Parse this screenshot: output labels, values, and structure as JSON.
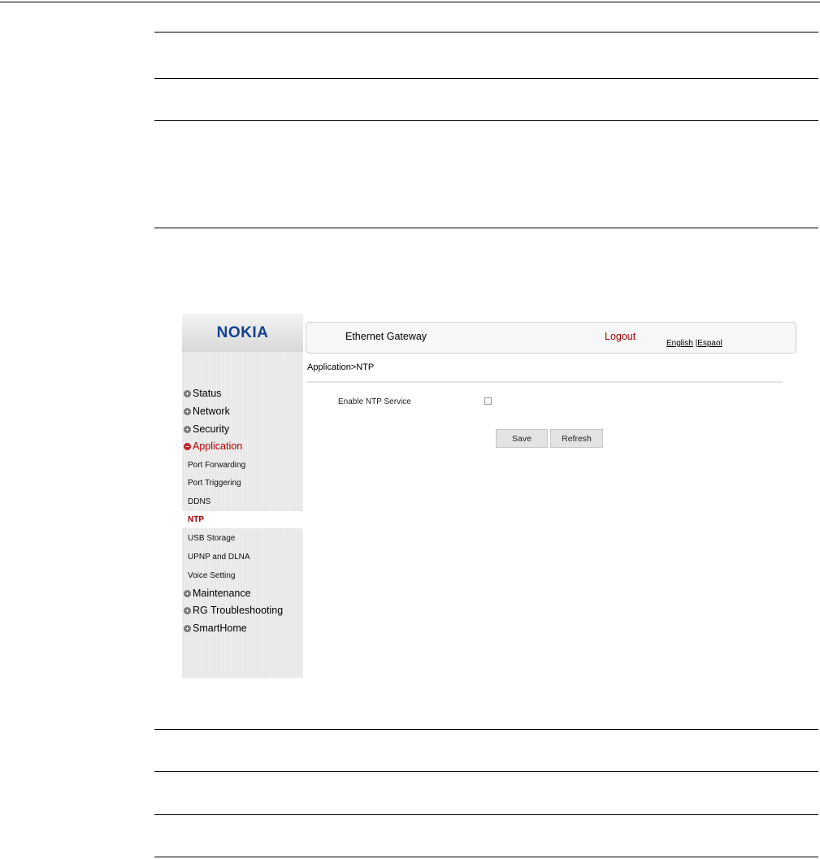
{
  "app": {
    "brand": "NOKIA",
    "header_title": "Ethernet Gateway",
    "logout": "Logout"
  },
  "language": {
    "english": "English",
    "separator": "|",
    "spanish": "Espaol"
  },
  "breadcrumb": "Application>NTP",
  "sidebar": {
    "top_items": [
      {
        "label": "Status",
        "state": "collapsed"
      },
      {
        "label": "Network",
        "state": "collapsed"
      },
      {
        "label": "Security",
        "state": "collapsed"
      },
      {
        "label": "Application",
        "state": "expanded"
      },
      {
        "label": "Maintenance",
        "state": "collapsed"
      },
      {
        "label": "RG Troubleshooting",
        "state": "collapsed"
      },
      {
        "label": "SmartHome",
        "state": "collapsed"
      }
    ],
    "sub_items": [
      {
        "label": "Port Forwarding"
      },
      {
        "label": "Port Triggering"
      },
      {
        "label": "DDNS"
      },
      {
        "label": "NTP",
        "selected": true
      },
      {
        "label": "USB Storage"
      },
      {
        "label": "UPNP and DLNA"
      },
      {
        "label": "Voice Setting"
      }
    ]
  },
  "form": {
    "enable_ntp_label": "Enable NTP Service",
    "enable_ntp_checked": false
  },
  "buttons": {
    "save": "Save",
    "refresh": "Refresh"
  },
  "colors": {
    "brand": "#124191",
    "accent_red": "#a00000",
    "expanded_bullet": "#c0202a"
  }
}
